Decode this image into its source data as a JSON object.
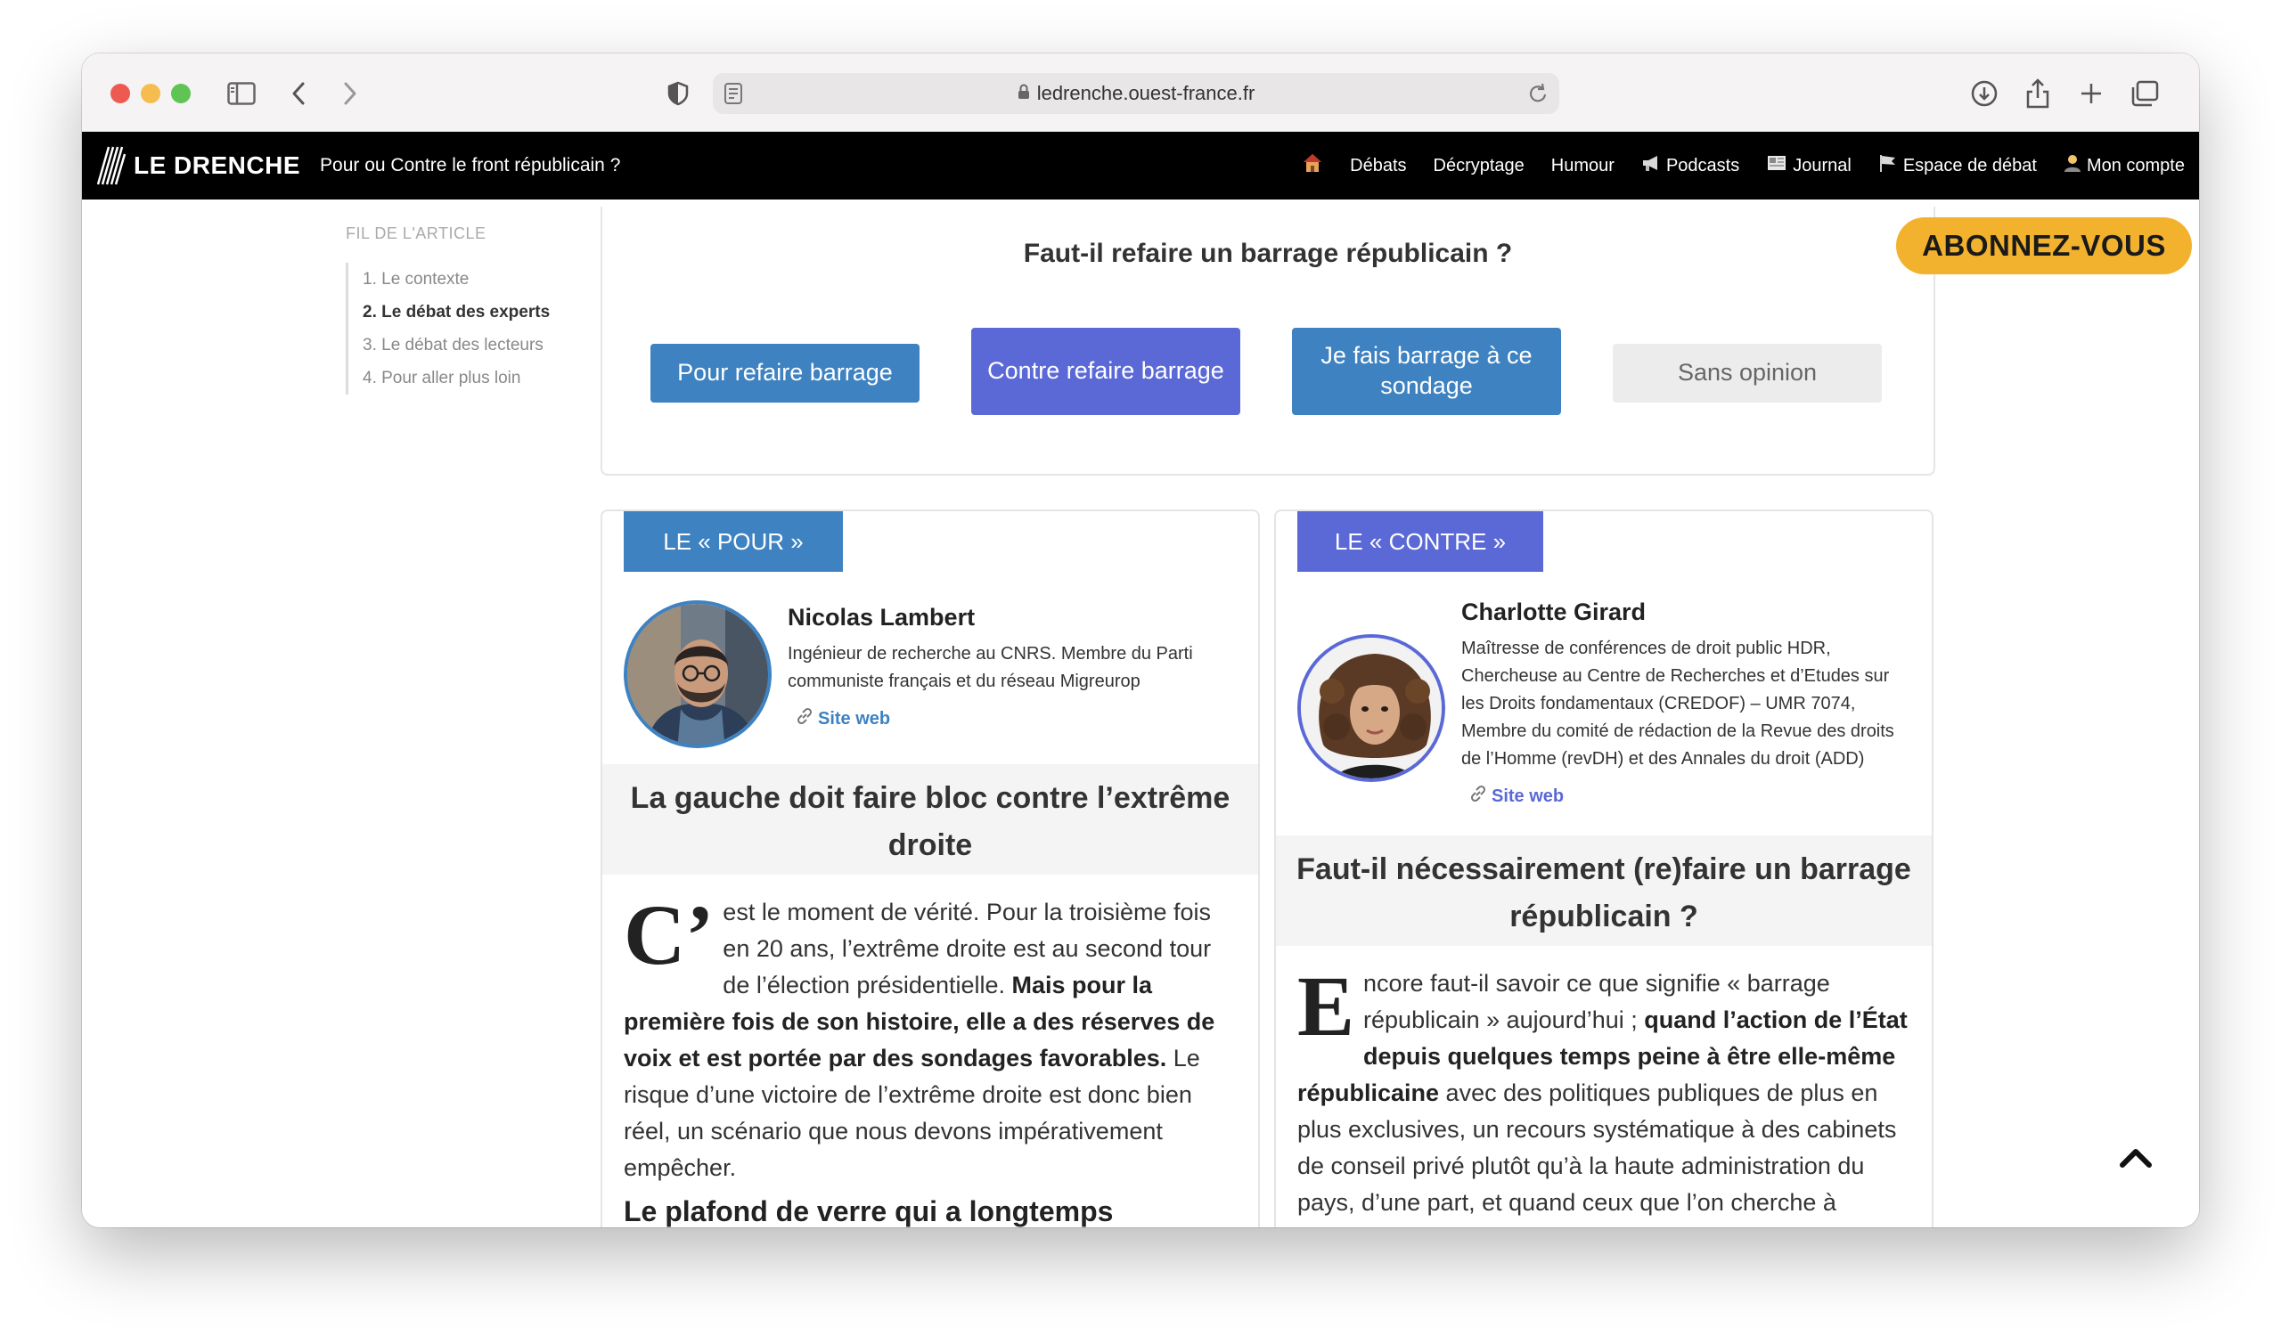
{
  "browser": {
    "url": "ledrenche.ouest-france.fr"
  },
  "site": {
    "logo_text": "LE DRENCHE",
    "subtitle": "Pour ou Contre le front républicain ?",
    "nav": [
      {
        "label": "Débats"
      },
      {
        "label": "Décryptage"
      },
      {
        "label": "Humour"
      },
      {
        "label": "Podcasts",
        "icon": "megaphone-icon"
      },
      {
        "label": "Journal",
        "icon": "newspaper-icon"
      },
      {
        "label": "Espace de débat",
        "icon": "flag-icon"
      },
      {
        "label": "Mon compte",
        "icon": "user-icon"
      }
    ],
    "home_icon": "house-icon"
  },
  "toc": {
    "title": "FIL DE L'ARTICLE",
    "items": [
      "1. Le contexte",
      "2. Le débat des experts",
      "3. Le débat des lecteurs",
      "4. Pour aller plus loin"
    ],
    "active_index": 1
  },
  "poll": {
    "question": "Faut-il refaire un barrage républicain ?",
    "options": [
      "Pour refaire barrage",
      "Contre refaire barrage",
      "Je fais barrage à ce sondage",
      "Sans opinion"
    ]
  },
  "subscribe_label": "ABONNEZ-VOUS",
  "pour": {
    "tab": "LE « POUR »",
    "name": "Nicolas Lambert",
    "bio": "Ingénieur de recherche au CNRS. Membre du Parti communiste français et du réseau Migreurop",
    "link": "Site web",
    "headline": "La gauche doit faire bloc contre l’extrême droite",
    "dropcap": "C’",
    "text1": "est le moment de vérité. Pour la troisième fois en 20 ans, l’extrême droite est au second tour de l’élection présidentielle. ",
    "text_bold": "Mais pour la première fois de son histoire, elle a des réserves de voix et est portée par des sondages favorables.",
    "text2": " Le risque d’une victoire de l’extrême droite est donc bien réel, un scénario que nous devons impérativement empêcher.",
    "subhead": "Le plafond de verre qui a longtemps"
  },
  "contre": {
    "tab": "LE « CONTRE »",
    "name": "Charlotte Girard",
    "bio": "Maîtresse de conférences de droit public HDR, Chercheuse au Centre de Recherches et d’Etudes sur les Droits fondamentaux (CREDOF) – UMR 7074, Membre du comité de rédaction de la Revue des droits de l’Homme (revDH) et des Annales du droit (ADD)",
    "link": "Site web",
    "headline": "Faut-il nécessairement (re)faire un barrage républicain ?",
    "dropcap": "E",
    "text1": "ncore faut-il savoir ce que signifie « barrage républicain » aujourd’hui ; ",
    "text_bold": "quand l’action de l’État depuis quelques temps peine à être elle-même républicaine",
    "text2": " avec des politiques publiques de plus en plus exclusives, un recours systématique à des cabinets de conseil privé plutôt qu’à la haute administration du pays, d’une part, et quand ceux que l’on cherche à"
  },
  "colors": {
    "pour": "#3e82c1",
    "contre": "#5b69d6",
    "subscribe": "#f3b22d",
    "nav_bg": "#000000"
  }
}
